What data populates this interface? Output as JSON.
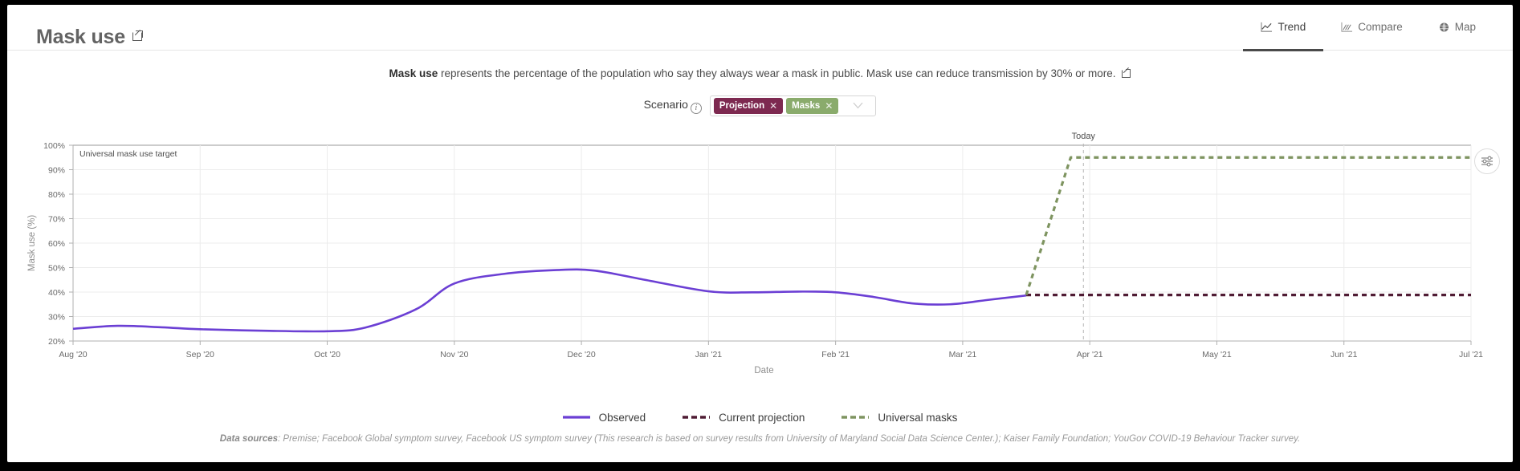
{
  "header": {
    "title": "Mask use",
    "title_link_icon": "external-link-icon",
    "tabs": [
      {
        "label": "Trend",
        "icon": "line-chart-icon",
        "active": true
      },
      {
        "label": "Compare",
        "icon": "bar-chart-icon",
        "active": false
      },
      {
        "label": "Map",
        "icon": "globe-icon",
        "active": false
      }
    ]
  },
  "description": {
    "bold_lead": "Mask use",
    "text": " represents the percentage of the population who say they always wear a mask in public. Mask use can reduce transmission by 30% or more.",
    "link_icon": "external-link-icon"
  },
  "scenario": {
    "label": "Scenario",
    "info_icon": "info-icon",
    "chips": [
      {
        "label": "Projection",
        "color": "#7d2950",
        "remove_icon": "close-icon"
      },
      {
        "label": "Masks",
        "color": "#8aab6c",
        "remove_icon": "close-icon"
      }
    ],
    "caret_icon": "chevron-down-icon"
  },
  "chart_toolbar": {
    "settings_icon": "sliders-icon"
  },
  "legend": [
    {
      "label": "Observed",
      "color": "#6b3fd4",
      "style": "solid"
    },
    {
      "label": "Current projection",
      "color": "#4f1b33",
      "style": "dashed"
    },
    {
      "label": "Universal masks",
      "color": "#7e9460",
      "style": "dashed"
    }
  ],
  "sources": {
    "label": "Data sources",
    "text": ": Premise; Facebook Global symptom survey, Facebook US symptom survey (This research is based on survey results from University of Maryland Social Data Science Center.); Kaiser Family Foundation; YouGov COVID-19 Behaviour Tracker survey."
  },
  "chart_data": {
    "type": "line",
    "title": "",
    "xlabel": "Date",
    "ylabel": "Mask use (%)",
    "ylim": [
      20,
      100
    ],
    "yticks": [
      "20%",
      "30%",
      "40%",
      "50%",
      "60%",
      "70%",
      "80%",
      "90%",
      "100%"
    ],
    "ytick_values": [
      20,
      30,
      40,
      50,
      60,
      70,
      80,
      90,
      100
    ],
    "xticks": [
      "Aug '20",
      "Sep '20",
      "Oct '20",
      "Nov '20",
      "Dec '20",
      "Jan '21",
      "Feb '21",
      "Mar '21",
      "Apr '21",
      "May '21",
      "Jun '21",
      "Jul '21"
    ],
    "xtick_values": [
      0,
      1,
      2,
      3,
      4,
      5,
      6,
      7,
      8,
      9,
      10,
      11
    ],
    "grid": true,
    "legend_position": "bottom",
    "annotations": [
      {
        "name": "universal-mask-use-target",
        "label": "Universal mask use target",
        "y": 100,
        "style": "solid-horizontal-line",
        "color": "#9a9a9a"
      },
      {
        "name": "today-marker",
        "label": "Today",
        "x": 7.95,
        "style": "dashed-vertical-line",
        "color": "#b5b5b5"
      }
    ],
    "series": [
      {
        "name": "Observed",
        "color": "#6b3fd4",
        "style": "solid",
        "x": [
          0.0,
          0.35,
          0.7,
          1.0,
          1.5,
          2.0,
          2.3,
          2.7,
          3.0,
          3.4,
          3.8,
          4.1,
          4.5,
          5.0,
          5.35,
          5.7,
          6.0,
          6.3,
          6.6,
          6.9,
          7.2,
          7.5
        ],
        "y": [
          25.0,
          26.2,
          25.6,
          24.8,
          24.2,
          24.0,
          25.5,
          33.0,
          43.5,
          47.5,
          49.0,
          48.8,
          45.0,
          40.3,
          39.9,
          40.2,
          39.9,
          38.0,
          35.4,
          35.0,
          36.8,
          38.6
        ]
      },
      {
        "name": "Current projection",
        "color": "#4f1b33",
        "style": "dashed",
        "x": [
          7.5,
          11.0
        ],
        "y": [
          38.8,
          38.8
        ]
      },
      {
        "name": "Universal masks",
        "color": "#7e9460",
        "style": "dashed",
        "x": [
          7.5,
          7.85,
          11.0
        ],
        "y": [
          38.8,
          95.0,
          95.0
        ]
      }
    ]
  }
}
